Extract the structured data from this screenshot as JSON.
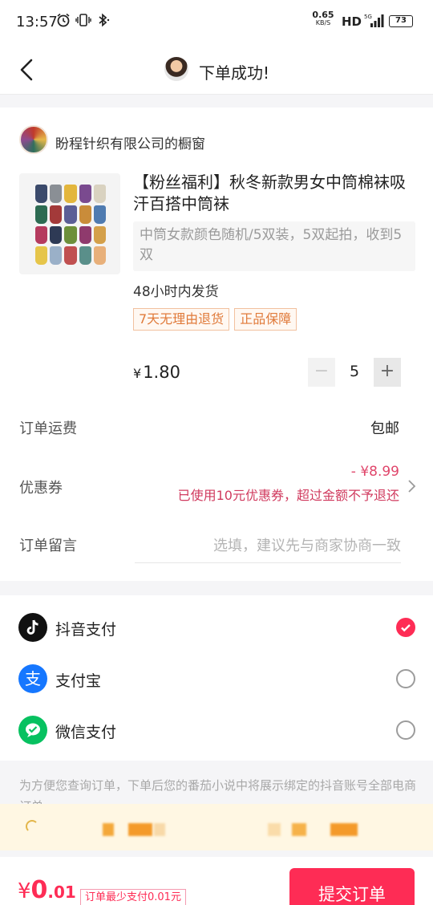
{
  "status_bar": {
    "time": "13:57",
    "net_rate": "0.65",
    "net_unit": "KB/S",
    "hd": "HD",
    "battery": "73",
    "icons": [
      "alarm-icon",
      "vibrate-icon",
      "bluetooth-icon",
      "signal-icon",
      "battery-icon"
    ]
  },
  "nav": {
    "title": "下单成功!"
  },
  "shop": {
    "name": "盼程针织有限公司的橱窗"
  },
  "product": {
    "title": "【粉丝福利】秋冬新款男女中筒棉袜吸汗百搭中筒袜",
    "sku": "中筒女款颜色随机/5双装，5双起拍，收到5双",
    "ship_time": "48小时内发货",
    "tags": [
      "7天无理由退货",
      "正品保障"
    ],
    "currency": "¥",
    "price": "1.80",
    "quantity": "5",
    "minus": "−",
    "plus": "+"
  },
  "order": {
    "shipping_label": "订单运费",
    "shipping_value": "包邮",
    "coupon_label": "优惠券",
    "coupon_amount": "- ¥8.99",
    "coupon_note": "已使用10元优惠券，超过金额不予退还",
    "remark_label": "订单留言",
    "remark_placeholder": "选填，建议先与商家协商一致"
  },
  "payment": {
    "methods": [
      {
        "label": "抖音支付",
        "icon": "douyin-pay-icon",
        "selected": true
      },
      {
        "label": "支付宝",
        "icon": "alipay-icon",
        "selected": false
      },
      {
        "label": "微信支付",
        "icon": "wechat-pay-icon",
        "selected": false
      }
    ],
    "alipay_glyph": "支"
  },
  "notice": "为方便您查询订单，下单后您的番茄小说中将展示绑定的抖音账号全部电商订单",
  "footer": {
    "currency": "¥",
    "total_int": "0",
    "total_dec": ".01",
    "min_pay": "订单最少支付0.01元",
    "submit": "提交订单"
  },
  "colors": {
    "accent": "#fe2c55",
    "coupon": "#e0466b",
    "tag": "#e07a3a",
    "alipay": "#1677ff",
    "wechat": "#07c160"
  }
}
